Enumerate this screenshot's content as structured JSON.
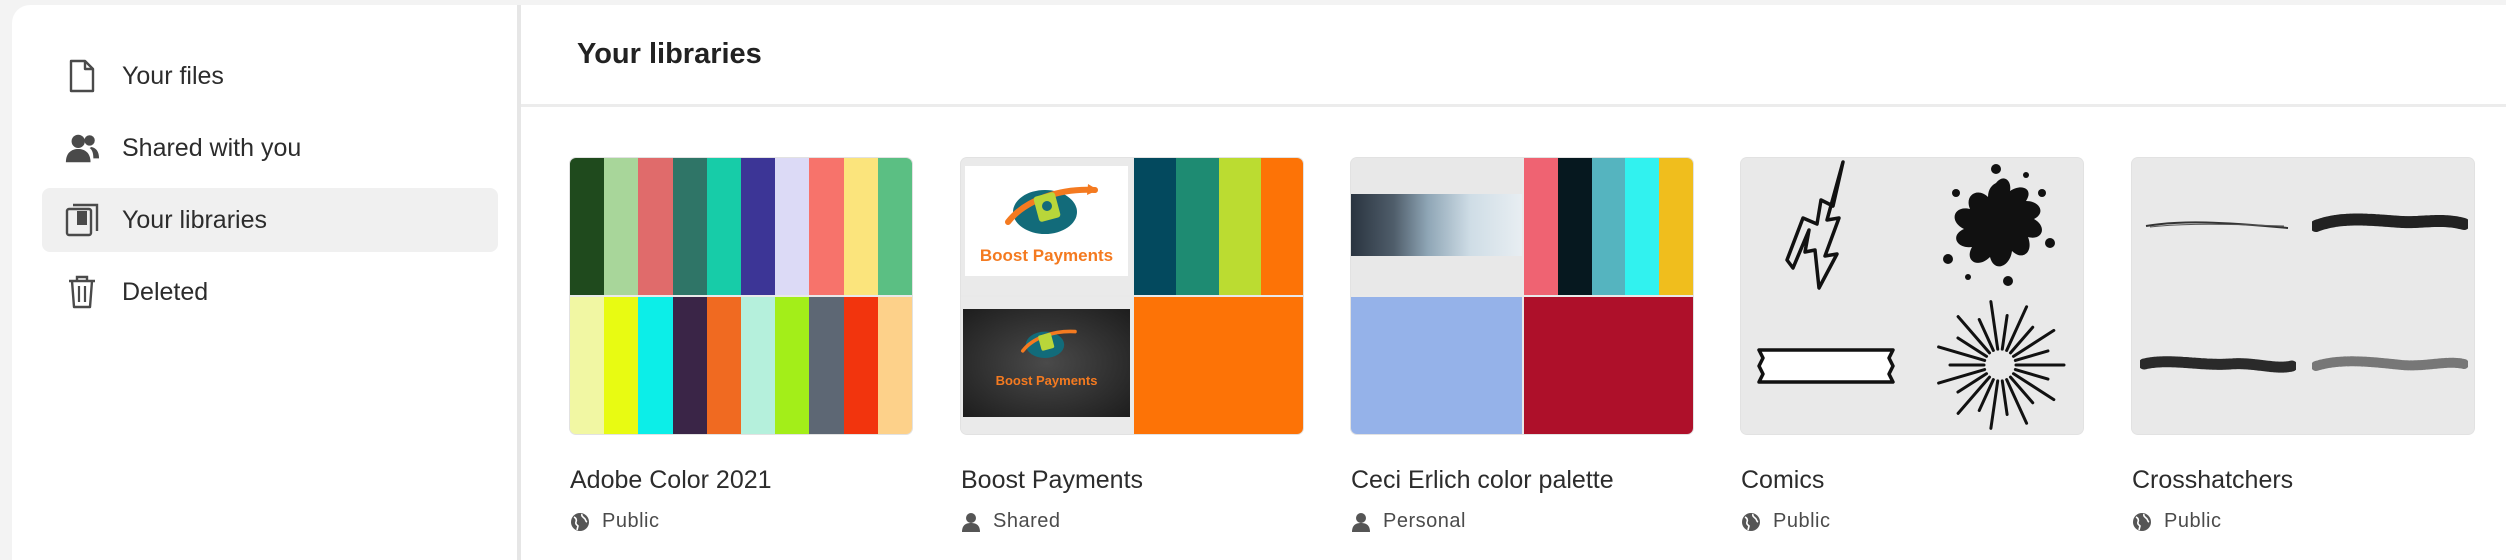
{
  "sidebar": {
    "items": [
      {
        "label": "Your files",
        "icon": "file-icon",
        "active": false
      },
      {
        "label": "Shared with you",
        "icon": "users-icon",
        "active": false
      },
      {
        "label": "Your libraries",
        "icon": "library-icon",
        "active": true
      },
      {
        "label": "Deleted",
        "icon": "trash-icon",
        "active": false
      }
    ]
  },
  "header": {
    "title": "Your libraries"
  },
  "libraries": [
    {
      "title": "Adobe Color 2021",
      "visibility": "Public",
      "visibility_icon": "globe-icon",
      "colors_top": [
        "#1f4a1d",
        "#a8d69a",
        "#e06b6b",
        "#2f7567",
        "#17cca8",
        "#3c3596",
        "#dcdaf6",
        "#f7736b",
        "#fbe47c",
        "#5bbf83"
      ],
      "colors_bottom": [
        "#f1f7a3",
        "#e8fb12",
        "#0ceee8",
        "#3a2547",
        "#f06a21",
        "#b5f0dc",
        "#a3ee19",
        "#5d6774",
        "#f2340d",
        "#fdd18a"
      ]
    },
    {
      "title": "Boost Payments",
      "visibility": "Shared",
      "visibility_icon": "user-icon",
      "logo_text": "Boost Payments",
      "colors_top": [
        "#03495e",
        "#1e8b72",
        "#bbdc31",
        "#fd7306"
      ],
      "color_bottom": "#fd7306"
    },
    {
      "title": "Ceci Erlich color palette",
      "visibility": "Personal",
      "visibility_icon": "user-icon",
      "colors_top": [
        "#ef6372",
        "#06181f",
        "#55b4bf",
        "#31f2ef",
        "#f0be1d"
      ],
      "color_bottom_left": "#95b2e9",
      "color_bottom_right": "#ae102a"
    },
    {
      "title": "Comics",
      "visibility": "Public",
      "visibility_icon": "globe-icon",
      "brushes": [
        "lightning-icon",
        "splat-icon",
        "tape-icon",
        "burst-icon"
      ]
    },
    {
      "title": "Crosshatchers",
      "visibility": "Public",
      "visibility_icon": "globe-icon",
      "brushes": [
        "thin-stroke-icon",
        "thick-stroke-icon",
        "hatch-stroke-icon",
        "light-hatch-stroke-icon"
      ]
    }
  ]
}
